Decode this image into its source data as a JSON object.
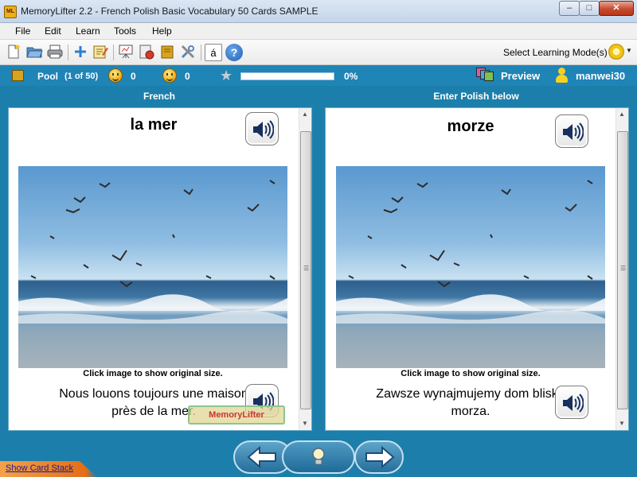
{
  "window": {
    "title": "MemoryLifter 2.2 - French Polish Basic Vocabulary 50 Cards SAMPLE",
    "icon_text": "ML",
    "min": "–",
    "max": "□",
    "close": "✕"
  },
  "menu": [
    "File",
    "Edit",
    "Learn",
    "Tools",
    "Help"
  ],
  "toolbar": {
    "buttons": [
      "new-file-icon",
      "open-folder-icon",
      "print-icon",
      "add-card-icon",
      "edit-card-icon",
      "presentation-icon",
      "settings-icon",
      "book-icon",
      "tools-icon",
      "special-char-icon",
      "help-icon"
    ],
    "special_char": "á",
    "help": "?",
    "mode_label": "Select Learning Mode(s)"
  },
  "status": {
    "pool_label": "Pool",
    "pool_count": "(1 of 50)",
    "known_count": "0",
    "unknown_count": "0",
    "progress_percent": 0,
    "progress_text": "0%",
    "preview_label": "Preview",
    "username": "manwei30"
  },
  "question": {
    "language_header": "French",
    "word": "la mer",
    "caption": "Click image to show original size.",
    "sentence": "Nous louons toujours une maison près de la mer."
  },
  "answer": {
    "language_header": "Enter Polish below",
    "word": "morze",
    "caption": "Click image to show original size.",
    "sentence": "Zawsze wynajmujemy dom blisko morza."
  },
  "watermark": "MemoryLifter",
  "bottom": {
    "show_stack_label": "Show Card Stack"
  },
  "colors": {
    "app_background": "#1c7fab",
    "status_bar": "#1f84b6",
    "progress_fill": "#6cbf4a",
    "show_stack_tab": "#e56d16"
  }
}
